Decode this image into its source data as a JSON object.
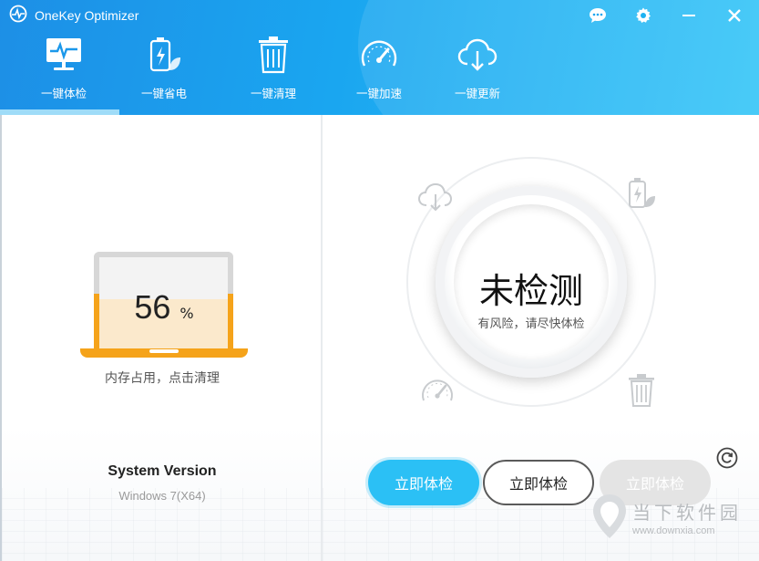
{
  "window": {
    "title": "OneKey Optimizer",
    "controls": [
      {
        "name": "feedback-icon",
        "label": ""
      },
      {
        "name": "gear-icon",
        "label": ""
      },
      {
        "name": "minimize-icon",
        "label": ""
      },
      {
        "name": "close-icon",
        "label": ""
      }
    ]
  },
  "nav": {
    "items": [
      {
        "label": "一键体检",
        "icon": "monitor-pulse-icon"
      },
      {
        "label": "一键省电",
        "icon": "battery-leaf-icon"
      },
      {
        "label": "一键清理",
        "icon": "trash-icon"
      },
      {
        "label": "一键加速",
        "icon": "speedometer-icon"
      },
      {
        "label": "一键更新",
        "icon": "cloud-download-icon"
      }
    ],
    "active_index": 0
  },
  "memory": {
    "value": "56",
    "unit": "%",
    "fill_fraction": 0.56,
    "hint": "内存占用，点击清理"
  },
  "system": {
    "title": "System Version",
    "value": "Windows 7(X64)"
  },
  "checkup": {
    "status": "未检测",
    "subtitle": "有风险，请尽快体检",
    "orbit_icons": [
      "cloud-download-icon",
      "battery-leaf-icon",
      "speedometer-icon",
      "trash-icon"
    ]
  },
  "buttons": {
    "primary": "立即体检",
    "secondary": "立即体检",
    "disabled": "立即体检"
  },
  "watermark": {
    "title": "当下软件园",
    "url": "www.downxia.com"
  },
  "colors": {
    "header_start": "#1d8fe6",
    "header_end": "#35c5f7",
    "accent": "#2bc0f5",
    "memory_orange": "#f5a31a"
  }
}
